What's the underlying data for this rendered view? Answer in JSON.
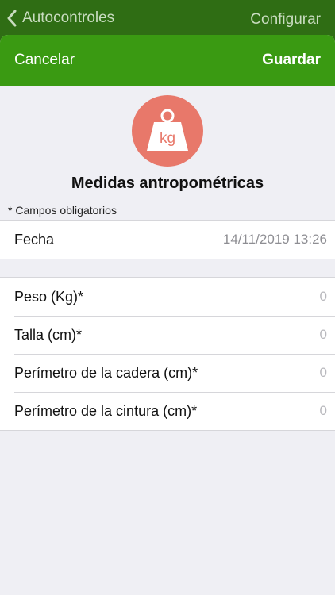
{
  "background_nav": {
    "back_label": "Autocontroles",
    "config_label": "Configurar"
  },
  "header": {
    "cancel_label": "Cancelar",
    "save_label": "Guardar"
  },
  "hero": {
    "icon_text": "kg",
    "title": "Medidas antropométricas"
  },
  "note": "* Campos obligatorios",
  "date_field": {
    "label": "Fecha",
    "value": "14/11/2019 13:26"
  },
  "measurements": [
    {
      "label": "Peso (Kg)*",
      "placeholder": "0"
    },
    {
      "label": "Talla (cm)*",
      "placeholder": "0"
    },
    {
      "label": "Perímetro de la cadera (cm)*",
      "placeholder": "0"
    },
    {
      "label": "Perímetro de la cintura (cm)*",
      "placeholder": "0"
    }
  ],
  "colors": {
    "header_green": "#3a9a12",
    "nav_dark_green": "#2f6d14",
    "icon_salmon": "#e8786a",
    "background": "#efeff4"
  }
}
